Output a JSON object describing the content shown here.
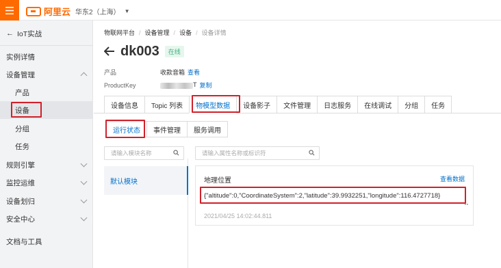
{
  "topbar": {
    "logo_text": "阿里云",
    "region": "华东2（上海）"
  },
  "sidebar": {
    "back_label": "IoT实战",
    "items": [
      {
        "label": "实例详情"
      },
      {
        "label": "设备管理"
      },
      {
        "label": "产品"
      },
      {
        "label": "设备"
      },
      {
        "label": "分组"
      },
      {
        "label": "任务"
      },
      {
        "label": "规则引擎"
      },
      {
        "label": "监控运维"
      },
      {
        "label": "设备划归"
      },
      {
        "label": "安全中心"
      },
      {
        "label": "文档与工具"
      }
    ]
  },
  "breadcrumb": [
    "物联网平台",
    "设备管理",
    "设备",
    "设备详情"
  ],
  "header": {
    "title": "dk003",
    "status": "在线"
  },
  "meta": {
    "product_key_label": "产品",
    "product_value": "收款音箱",
    "product_link": "查看",
    "productkey_key_label": "ProductKey",
    "productkey_suffix": "T",
    "productkey_link": "复制"
  },
  "tabs": [
    "设备信息",
    "Topic 列表",
    "物模型数据",
    "设备影子",
    "文件管理",
    "日志服务",
    "在线调试",
    "分组",
    "任务"
  ],
  "subtabs": [
    "运行状态",
    "事件管理",
    "服务调用"
  ],
  "module_search": {
    "placeholder": "请输入模块名称"
  },
  "property_search": {
    "placeholder": "请输入属性名称或标识符"
  },
  "modules": [
    "默认模块"
  ],
  "card": {
    "title": "地理位置",
    "link": "查看数据",
    "value": "{\"altitude\":0,\"CoordinateSystem\":2,\"latitude\":39.9932251,\"longitude\":116.4727718}",
    "time": "2021/04/25 14:02:44.811",
    "more": "⠉"
  }
}
